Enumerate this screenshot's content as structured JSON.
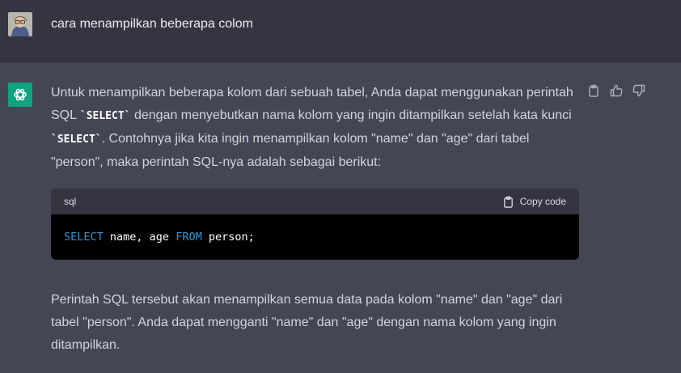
{
  "user_message": "cara menampilkan beberapa colom",
  "answer": {
    "para1": [
      "Untuk menampilkan beberapa kolom dari sebuah tabel, Anda dapat menggunakan perintah SQL ",
      "`SELECT`",
      " dengan menyebutkan nama kolom yang ingin ditampilkan setelah kata kunci ",
      "`SELECT`",
      ". Contohnya jika kita ingin menampilkan kolom \"name\" dan \"age\" dari tabel \"person\", maka perintah SQL-nya adalah sebagai berikut:"
    ],
    "code": {
      "language": "sql",
      "copy_label": "Copy code",
      "tokens": [
        "SELECT",
        " name, age ",
        "FROM",
        " person;"
      ]
    },
    "para2": "Perintah SQL tersebut akan menampilkan semua data pada kolom \"name\" dan \"age\" dari tabel \"person\". Anda dapat mengganti \"name\" dan \"age\" dengan nama kolom yang ingin ditampilkan."
  },
  "icons": [
    "user-avatar",
    "chatgpt-logo-icon",
    "clipboard-icon",
    "thumbs-up-icon",
    "thumbs-down-icon"
  ],
  "colors": {
    "user_bg": "#343541",
    "assistant_bg": "#444654",
    "logo_green": "#10a37f",
    "keyword_blue": "#2e95d3"
  }
}
